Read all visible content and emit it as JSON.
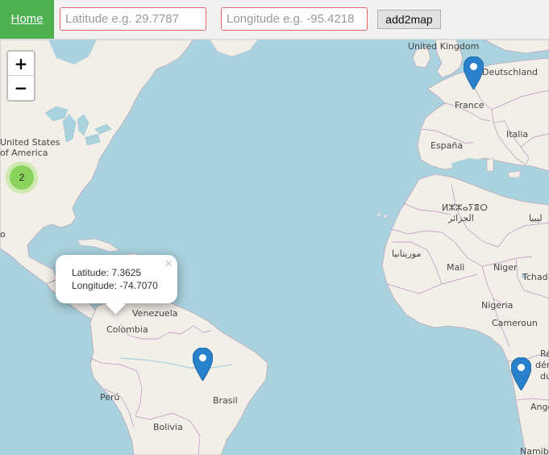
{
  "topbar": {
    "home_label": "Home",
    "latitude_placeholder": "Latitude e.g. 29.7787",
    "longitude_placeholder": "Longitude e.g. -95.4218",
    "add_button_label": "add2map"
  },
  "map": {
    "zoom_in_label": "+",
    "zoom_out_label": "−",
    "cluster_count": "2",
    "labels": {
      "united_kingdom": "United Kingdom",
      "deutschland": "Deutschland",
      "france": "France",
      "espana": "España",
      "italia": "Italia",
      "united_states_1": "United States",
      "united_states_2": "of America",
      "algeria_berber": "ⵍⵣⵣⴰⵢⴻⵔ",
      "algeria_arabic": "الجزائر",
      "libya": "ليبيا",
      "mauritania": "موريتانيا",
      "mali": "Mali",
      "niger": "Niger",
      "tchad": "Tchad",
      "nigeria": "Nigeria",
      "cameroun": "Cameroun",
      "venezuela": "Venezuela",
      "colombia": "Colombia",
      "peru": "Perú",
      "brasil": "Brasil",
      "bolivia": "Bolivia",
      "rdc_1": "Ré",
      "rdc_2": "dém",
      "rdc_3": "du",
      "angola": "Ango",
      "namibia": "Namibi",
      "mexico_fragment": "o"
    },
    "popup": {
      "latitude_text": "Latitude: 7.3625",
      "longitude_text": "Longitude: -74.7070",
      "close_symbol": "×"
    }
  },
  "colors": {
    "ocean": "#aad3df",
    "land": "#f2efe9",
    "home_green": "#4caf50",
    "marker_blue": "#2a81cb",
    "cluster_green": "#6ecc39",
    "field_border": "#e06666"
  }
}
